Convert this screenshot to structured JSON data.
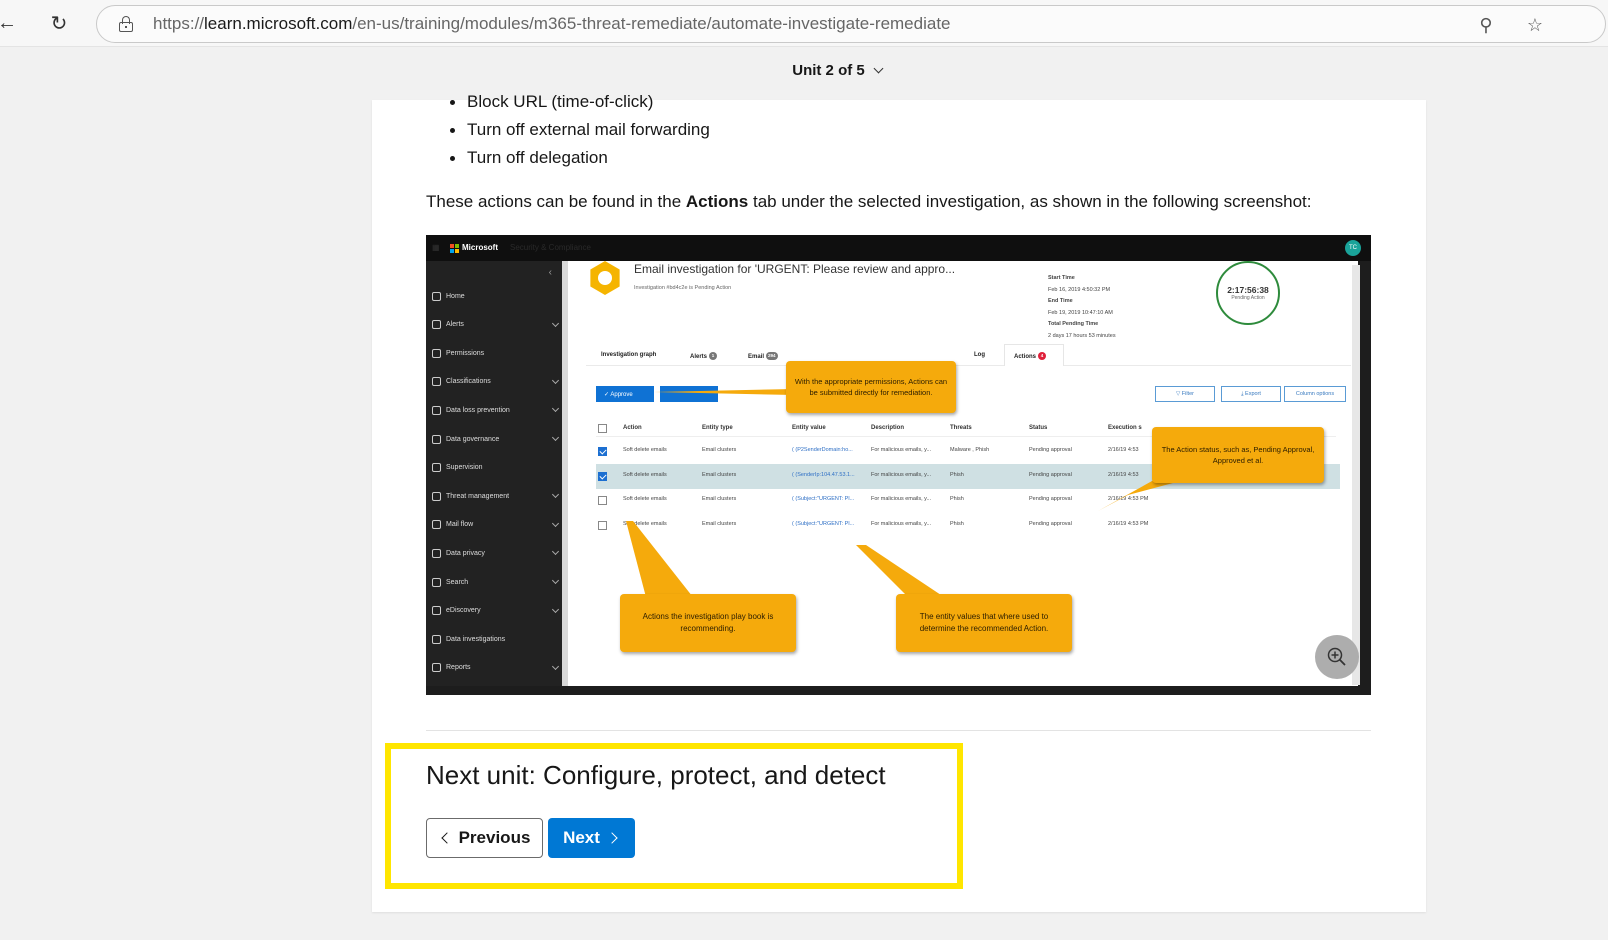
{
  "browser": {
    "url_scheme": "https://",
    "url_host": "learn.microsoft.com",
    "url_path": "/en-us/training/modules/m365-threat-remediate/automate-investigate-remediate",
    "back_icon": "back-arrow-icon",
    "refresh_icon": "refresh-icon",
    "zoom_icon": "zoom-out-icon",
    "favorite_icon": "star-icon"
  },
  "unit_header": {
    "label": "Unit 2 of 5"
  },
  "article": {
    "bullets": [
      "Block URL (time-of-click)",
      "Turn off external mail forwarding",
      "Turn off delegation"
    ],
    "intro_before": "These actions can be found in the ",
    "intro_bold": "Actions",
    "intro_after": " tab under the selected investigation, as shown in the following screenshot:"
  },
  "screenshot": {
    "brand": "Microsoft",
    "app_name": "Security & Compliance",
    "avatar_initials": "TC",
    "sidebar": [
      {
        "label": "Home",
        "caret": false
      },
      {
        "label": "Alerts",
        "caret": true
      },
      {
        "label": "Permissions",
        "caret": false
      },
      {
        "label": "Classifications",
        "caret": true
      },
      {
        "label": "Data loss prevention",
        "caret": true
      },
      {
        "label": "Data governance",
        "caret": true
      },
      {
        "label": "Supervision",
        "caret": false
      },
      {
        "label": "Threat management",
        "caret": true
      },
      {
        "label": "Mail flow",
        "caret": true
      },
      {
        "label": "Data privacy",
        "caret": true
      },
      {
        "label": "Search",
        "caret": true
      },
      {
        "label": "eDiscovery",
        "caret": true
      },
      {
        "label": "Data investigations",
        "caret": false
      },
      {
        "label": "Reports",
        "caret": true
      }
    ],
    "title": "Email investigation for 'URGENT: Please review and appro...",
    "subtitle": "Investigation #bd4c2e is Pending Action",
    "meta": {
      "start_label": "Start Time",
      "start_value": "Feb 16, 2019 4:50:32 PM",
      "end_label": "End Time",
      "end_value": "Feb 19, 2019 10:47:10 AM",
      "pending_label": "Total Pending Time",
      "pending_value": "2 days 17 hours 53 minutes"
    },
    "timer": {
      "value": "2:17:56:38",
      "label": "Pending Action"
    },
    "tabs": [
      {
        "label": "Investigation graph",
        "badge": ""
      },
      {
        "label": "Alerts",
        "badge": "1"
      },
      {
        "label": "Email",
        "badge": "294"
      },
      {
        "label": "Log",
        "badge": ""
      },
      {
        "label": "Actions",
        "badge": "4"
      }
    ],
    "buttons": {
      "approve": "✓ Approve",
      "filter": "▽ Filter",
      "export": "⤓ Export",
      "columns": "Column options"
    },
    "columns": [
      "Action",
      "Entity type",
      "Entity value",
      "Description",
      "Threats",
      "Status",
      "Execution s"
    ],
    "rows": [
      {
        "checked": true,
        "selected": false,
        "action": "Soft delete emails",
        "entity_type": "Email clusters",
        "entity_value": "( (P2SenderDomain:ho...",
        "description": "For malicious emails, y...",
        "threats": "Malware , Phish",
        "status": "Pending approval",
        "execution": "2/16/19 4:53"
      },
      {
        "checked": true,
        "selected": true,
        "action": "Soft delete emails",
        "entity_type": "Email clusters",
        "entity_value": "( (SenderIp:104.47.53.1...",
        "description": "For malicious emails, y...",
        "threats": "Phish",
        "status": "Pending approval",
        "execution": "2/16/19 4:53"
      },
      {
        "checked": false,
        "selected": false,
        "action": "Soft delete emails",
        "entity_type": "Email clusters",
        "entity_value": "( (Subject:\"URGENT: Pl...",
        "description": "For malicious emails, y...",
        "threats": "Phish",
        "status": "Pending approval",
        "execution": "2/16/19 4:53 PM"
      },
      {
        "checked": false,
        "selected": false,
        "action": "Soft delete emails",
        "entity_type": "Email clusters",
        "entity_value": "( (Subject:\"URGENT: Pl...",
        "description": "For malicious emails, y...",
        "threats": "Phish",
        "status": "Pending approval",
        "execution": "2/16/19 4:53 PM"
      }
    ],
    "callouts": {
      "permissions": "With the appropriate permissions, Actions can be submitted directly for remediation.",
      "status": "The Action status, such as, Pending Approval, Approved et al.",
      "playbook": "Actions the investigation play book is recommending.",
      "entity": "The entity values that where used to determine the recommended Action."
    },
    "colors": {
      "callout": "#f5aa0c",
      "approve": "#0f72d4",
      "timer_ring": "#2e8b3c"
    }
  },
  "next_unit": {
    "title": "Next unit: Configure, protect, and detect",
    "previous_label": "Previous",
    "next_label": "Next",
    "highlight_color": "#ffe600",
    "next_button_color": "#0078d4"
  }
}
